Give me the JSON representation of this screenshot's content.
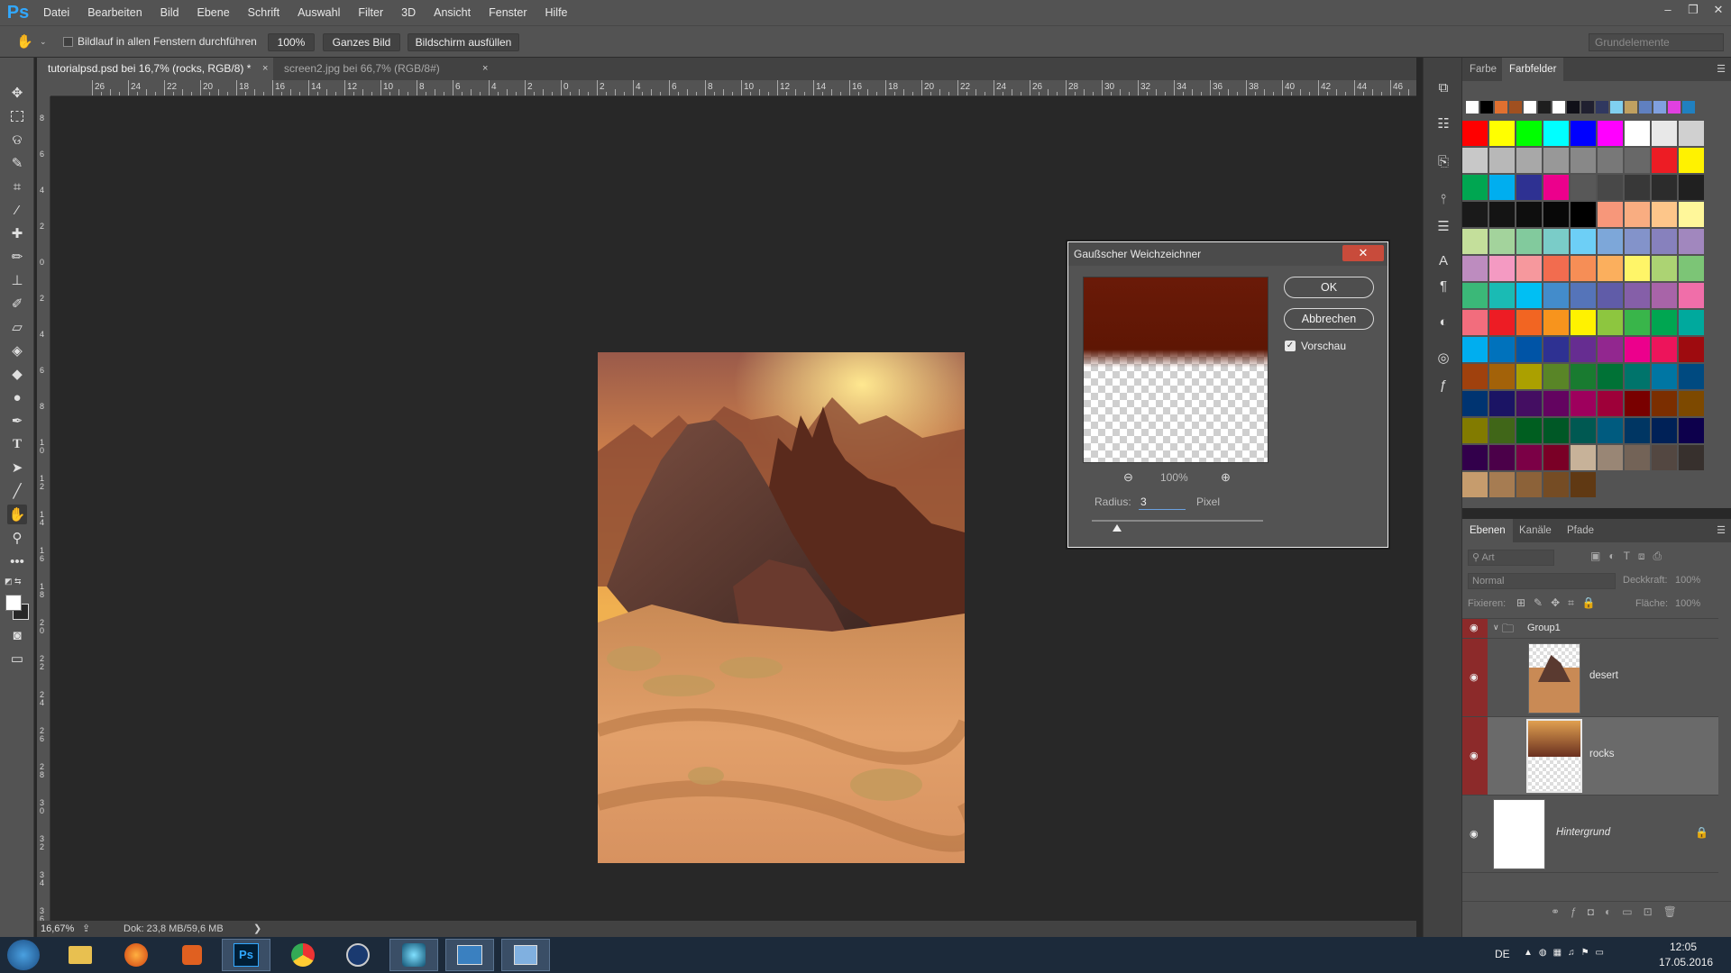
{
  "app": {
    "logo": "Ps",
    "menu": [
      "Datei",
      "Bearbeiten",
      "Bild",
      "Ebene",
      "Schrift",
      "Auswahl",
      "Filter",
      "3D",
      "Ansicht",
      "Fenster",
      "Hilfe"
    ],
    "window_controls": [
      "–",
      "❐",
      "✕"
    ]
  },
  "options_bar": {
    "tool_icon": "hand-icon",
    "scroll_all_label": "Bildlauf in allen Fenstern durchführen",
    "zoom_btn": "100%",
    "fit_btn": "Ganzes Bild",
    "fill_btn": "Bildschirm ausfüllen",
    "workspace": "Grundelemente"
  },
  "tabs": [
    {
      "label": "tutorialpsd.psd bei 16,7% (rocks, RGB/8) *",
      "active": true
    },
    {
      "label": "screen2.jpg bei 66,7% (RGB/8#)",
      "active": false
    }
  ],
  "ruler": {
    "h_labels": [
      "26",
      "24",
      "22",
      "20",
      "18",
      "16",
      "14",
      "12",
      "10",
      "8",
      "6",
      "4",
      "2",
      "0",
      "2",
      "4",
      "6",
      "8",
      "10",
      "12",
      "14",
      "16",
      "18",
      "20",
      "22",
      "24",
      "26",
      "28",
      "30",
      "32",
      "34",
      "36",
      "38",
      "40",
      "42",
      "44",
      "46"
    ],
    "v_labels": [
      "8",
      "6",
      "4",
      "2",
      "0",
      "2",
      "4",
      "6",
      "8",
      "10",
      "12",
      "14",
      "16",
      "18",
      "20",
      "22",
      "24",
      "26",
      "28",
      "30",
      "32",
      "34",
      "36"
    ]
  },
  "status": {
    "zoom": "16,67%",
    "doc": "Dok: 23,8 MB/59,6 MB"
  },
  "dialog": {
    "title": "Gaußscher Weichzeichner",
    "ok": "OK",
    "cancel": "Abbrechen",
    "preview_label": "Vorschau",
    "preview_checked": true,
    "zoom": "100%",
    "radius_label": "Radius:",
    "radius_value": "3",
    "radius_unit": "Pixel",
    "close": "✕"
  },
  "swatches_panel": {
    "tabs": [
      "Farbe",
      "Farbfelder"
    ],
    "recent": [
      "#ffffff",
      "#000000",
      "#e07030",
      "#a05020",
      "#ffffff",
      "#1e1e1e",
      "#ffffff",
      "#101018",
      "#202030",
      "#303860",
      "#80d0f0",
      "#c0a060",
      "#6080c0",
      "#80a0e0",
      "#e040e0",
      "#2080c0"
    ],
    "grid": [
      [
        "#ff0000",
        "#ffff00",
        "#00ff00",
        "#00ffff",
        "#0000ff",
        "#ff00ff",
        "#ffffff",
        "#e8e8e8",
        "#d0d0d0"
      ],
      [
        "#c8c8c8",
        "#b8b8b8",
        "#a8a8a8",
        "#989898",
        "#888888",
        "#787878",
        "#686868",
        "#ed1c24",
        "#fff200"
      ],
      [
        "#00a651",
        "#00aeef",
        "#2e3192",
        "#ec008c",
        "#585858",
        "#484848",
        "#383838",
        "#2c2c2c",
        "#202020"
      ],
      [
        "#1a1a1a",
        "#141414",
        "#0e0e0e",
        "#080808",
        "#000000",
        "#f7977a",
        "#f9ad81",
        "#fdc68a",
        "#fff79a"
      ],
      [
        "#c4df9b",
        "#a3d39c",
        "#82ca9d",
        "#7accc8",
        "#6dcff6",
        "#7da7d9",
        "#8393ca",
        "#8781bd",
        "#a187be"
      ],
      [
        "#bd8cbf",
        "#f49ac2",
        "#f6989d",
        "#f26c4f",
        "#f68e56",
        "#fbaf5d",
        "#fff568",
        "#acd373",
        "#7cc576"
      ],
      [
        "#3bb878",
        "#1abbb4",
        "#00bff3",
        "#438ccb",
        "#5574b9",
        "#605ca8",
        "#855fa8",
        "#a864a8",
        "#f06ea9"
      ],
      [
        "#f26d7d",
        "#ed1c24",
        "#f26522",
        "#f7941d",
        "#fff200",
        "#8dc63f",
        "#39b54a",
        "#00a651",
        "#00a99d"
      ],
      [
        "#00aeef",
        "#0072bc",
        "#0054a6",
        "#2e3192",
        "#662d91",
        "#92278f",
        "#ec008c",
        "#ed145b",
        "#9e0b0f"
      ],
      [
        "#a0410d",
        "#a36209",
        "#aba000",
        "#598527",
        "#197b30",
        "#007236",
        "#00746b",
        "#0076a3",
        "#004a80"
      ],
      [
        "#003471",
        "#1b1464",
        "#440e62",
        "#630460",
        "#9e005d",
        "#9e0039",
        "#790000",
        "#7b2e00",
        "#7d4900"
      ],
      [
        "#827b00",
        "#406618",
        "#005e20",
        "#005826",
        "#005952",
        "#005b7f",
        "#003663",
        "#002157",
        "#0d004c"
      ],
      [
        "#32004b",
        "#4b0049",
        "#7b0046",
        "#7a0026",
        "#c7b299",
        "#998675",
        "#736357",
        "#534741",
        "#37302d"
      ],
      [
        "#c69c6d",
        "#a67c52",
        "#8c6239",
        "#754c24",
        "#603913"
      ]
    ]
  },
  "layers_panel": {
    "tabs": [
      "Ebenen",
      "Kanäle",
      "Pfade"
    ],
    "filter_placeholder": "Art",
    "blend_mode": "Normal",
    "opacity_label": "Deckkraft:",
    "opacity_value": "100%",
    "lock_label": "Fixieren:",
    "fill_label": "Fläche:",
    "fill_value": "100%",
    "layers": [
      {
        "name": "Group1",
        "type": "group"
      },
      {
        "name": "desert",
        "type": "layer"
      },
      {
        "name": "rocks",
        "type": "layer",
        "selected": true
      },
      {
        "name": "Hintergrund",
        "type": "background",
        "locked": true
      }
    ]
  },
  "taskbar": {
    "lang": "DE",
    "time": "12:05",
    "date": "17.05.2016"
  }
}
